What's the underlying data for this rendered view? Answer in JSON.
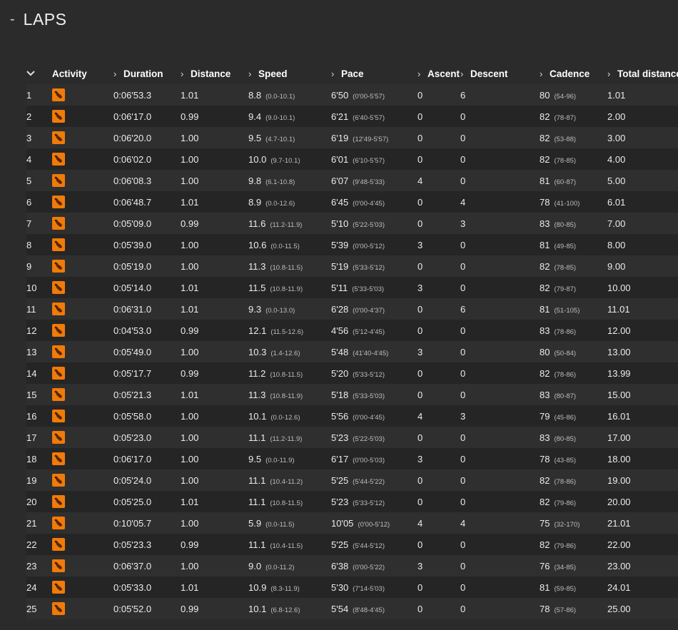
{
  "section": {
    "toggle": "-",
    "title": "LAPS"
  },
  "table": {
    "columns": [
      "Activity",
      "Duration",
      "Distance",
      "Speed",
      "Pace",
      "Ascent",
      "Descent",
      "Cadence",
      "Total distance"
    ],
    "icon": "running-shoe-icon",
    "accent": "#f07a0a",
    "rows": [
      {
        "n": "1",
        "dur": "0:06'53.3",
        "dist": "1.01",
        "spd": "8.8",
        "spdr": "(0.0-10.1)",
        "pace": "6'50",
        "pacer": "(0'00-5'57)",
        "asc": "0",
        "desc": "6",
        "cad": "80",
        "cadr": "(54-96)",
        "tot": "1.01"
      },
      {
        "n": "2",
        "dur": "0:06'17.0",
        "dist": "0.99",
        "spd": "9.4",
        "spdr": "(9.0-10.1)",
        "pace": "6'21",
        "pacer": "(6'40-5'57)",
        "asc": "0",
        "desc": "0",
        "cad": "82",
        "cadr": "(78-87)",
        "tot": "2.00"
      },
      {
        "n": "3",
        "dur": "0:06'20.0",
        "dist": "1.00",
        "spd": "9.5",
        "spdr": "(4.7-10.1)",
        "pace": "6'19",
        "pacer": "(12'49-5'57)",
        "asc": "0",
        "desc": "0",
        "cad": "82",
        "cadr": "(53-88)",
        "tot": "3.00"
      },
      {
        "n": "4",
        "dur": "0:06'02.0",
        "dist": "1.00",
        "spd": "10.0",
        "spdr": "(9.7-10.1)",
        "pace": "6'01",
        "pacer": "(6'10-5'57)",
        "asc": "0",
        "desc": "0",
        "cad": "82",
        "cadr": "(78-85)",
        "tot": "4.00"
      },
      {
        "n": "5",
        "dur": "0:06'08.3",
        "dist": "1.00",
        "spd": "9.8",
        "spdr": "(6.1-10.8)",
        "pace": "6'07",
        "pacer": "(9'48-5'33)",
        "asc": "4",
        "desc": "0",
        "cad": "81",
        "cadr": "(60-87)",
        "tot": "5.00"
      },
      {
        "n": "6",
        "dur": "0:06'48.7",
        "dist": "1.01",
        "spd": "8.9",
        "spdr": "(0.0-12.6)",
        "pace": "6'45",
        "pacer": "(0'00-4'45)",
        "asc": "0",
        "desc": "4",
        "cad": "78",
        "cadr": "(41-100)",
        "tot": "6.01"
      },
      {
        "n": "7",
        "dur": "0:05'09.0",
        "dist": "0.99",
        "spd": "11.6",
        "spdr": "(11.2-11.9)",
        "pace": "5'10",
        "pacer": "(5'22-5'03)",
        "asc": "0",
        "desc": "3",
        "cad": "83",
        "cadr": "(80-85)",
        "tot": "7.00"
      },
      {
        "n": "8",
        "dur": "0:05'39.0",
        "dist": "1.00",
        "spd": "10.6",
        "spdr": "(0.0-11.5)",
        "pace": "5'39",
        "pacer": "(0'00-5'12)",
        "asc": "3",
        "desc": "0",
        "cad": "81",
        "cadr": "(49-85)",
        "tot": "8.00"
      },
      {
        "n": "9",
        "dur": "0:05'19.0",
        "dist": "1.00",
        "spd": "11.3",
        "spdr": "(10.8-11.5)",
        "pace": "5'19",
        "pacer": "(5'33-5'12)",
        "asc": "0",
        "desc": "0",
        "cad": "82",
        "cadr": "(78-85)",
        "tot": "9.00"
      },
      {
        "n": "10",
        "dur": "0:05'14.0",
        "dist": "1.01",
        "spd": "11.5",
        "spdr": "(10.8-11.9)",
        "pace": "5'11",
        "pacer": "(5'33-5'03)",
        "asc": "3",
        "desc": "0",
        "cad": "82",
        "cadr": "(79-87)",
        "tot": "10.00"
      },
      {
        "n": "11",
        "dur": "0:06'31.0",
        "dist": "1.01",
        "spd": "9.3",
        "spdr": "(0.0-13.0)",
        "pace": "6'28",
        "pacer": "(0'00-4'37)",
        "asc": "0",
        "desc": "6",
        "cad": "81",
        "cadr": "(51-105)",
        "tot": "11.01"
      },
      {
        "n": "12",
        "dur": "0:04'53.0",
        "dist": "0.99",
        "spd": "12.1",
        "spdr": "(11.5-12.6)",
        "pace": "4'56",
        "pacer": "(5'12-4'45)",
        "asc": "0",
        "desc": "0",
        "cad": "83",
        "cadr": "(78-86)",
        "tot": "12.00"
      },
      {
        "n": "13",
        "dur": "0:05'49.0",
        "dist": "1.00",
        "spd": "10.3",
        "spdr": "(1.4-12.6)",
        "pace": "5'48",
        "pacer": "(41'40-4'45)",
        "asc": "3",
        "desc": "0",
        "cad": "80",
        "cadr": "(50-84)",
        "tot": "13.00"
      },
      {
        "n": "14",
        "dur": "0:05'17.7",
        "dist": "0.99",
        "spd": "11.2",
        "spdr": "(10.8-11.5)",
        "pace": "5'20",
        "pacer": "(5'33-5'12)",
        "asc": "0",
        "desc": "0",
        "cad": "82",
        "cadr": "(78-86)",
        "tot": "13.99"
      },
      {
        "n": "15",
        "dur": "0:05'21.3",
        "dist": "1.01",
        "spd": "11.3",
        "spdr": "(10.8-11.9)",
        "pace": "5'18",
        "pacer": "(5'33-5'03)",
        "asc": "0",
        "desc": "0",
        "cad": "83",
        "cadr": "(80-87)",
        "tot": "15.00"
      },
      {
        "n": "16",
        "dur": "0:05'58.0",
        "dist": "1.00",
        "spd": "10.1",
        "spdr": "(0.0-12.6)",
        "pace": "5'56",
        "pacer": "(0'00-4'45)",
        "asc": "4",
        "desc": "3",
        "cad": "79",
        "cadr": "(45-86)",
        "tot": "16.01"
      },
      {
        "n": "17",
        "dur": "0:05'23.0",
        "dist": "1.00",
        "spd": "11.1",
        "spdr": "(11.2-11.9)",
        "pace": "5'23",
        "pacer": "(5'22-5'03)",
        "asc": "0",
        "desc": "0",
        "cad": "83",
        "cadr": "(80-85)",
        "tot": "17.00"
      },
      {
        "n": "18",
        "dur": "0:06'17.0",
        "dist": "1.00",
        "spd": "9.5",
        "spdr": "(0.0-11.9)",
        "pace": "6'17",
        "pacer": "(0'00-5'03)",
        "asc": "3",
        "desc": "0",
        "cad": "78",
        "cadr": "(43-85)",
        "tot": "18.00"
      },
      {
        "n": "19",
        "dur": "0:05'24.0",
        "dist": "1.00",
        "spd": "11.1",
        "spdr": "(10.4-11.2)",
        "pace": "5'25",
        "pacer": "(5'44-5'22)",
        "asc": "0",
        "desc": "0",
        "cad": "82",
        "cadr": "(78-86)",
        "tot": "19.00"
      },
      {
        "n": "20",
        "dur": "0:05'25.0",
        "dist": "1.01",
        "spd": "11.1",
        "spdr": "(10.8-11.5)",
        "pace": "5'23",
        "pacer": "(5'33-5'12)",
        "asc": "0",
        "desc": "0",
        "cad": "82",
        "cadr": "(79-86)",
        "tot": "20.00"
      },
      {
        "n": "21",
        "dur": "0:10'05.7",
        "dist": "1.00",
        "spd": "5.9",
        "spdr": "(0.0-11.5)",
        "pace": "10'05",
        "pacer": "(0'00-5'12)",
        "asc": "4",
        "desc": "4",
        "cad": "75",
        "cadr": "(32-170)",
        "tot": "21.01"
      },
      {
        "n": "22",
        "dur": "0:05'23.3",
        "dist": "0.99",
        "spd": "11.1",
        "spdr": "(10.4-11.5)",
        "pace": "5'25",
        "pacer": "(5'44-5'12)",
        "asc": "0",
        "desc": "0",
        "cad": "82",
        "cadr": "(79-86)",
        "tot": "22.00"
      },
      {
        "n": "23",
        "dur": "0:06'37.0",
        "dist": "1.00",
        "spd": "9.0",
        "spdr": "(0.0-11.2)",
        "pace": "6'38",
        "pacer": "(0'00-5'22)",
        "asc": "3",
        "desc": "0",
        "cad": "76",
        "cadr": "(34-85)",
        "tot": "23.00"
      },
      {
        "n": "24",
        "dur": "0:05'33.0",
        "dist": "1.01",
        "spd": "10.9",
        "spdr": "(8.3-11.9)",
        "pace": "5'30",
        "pacer": "(7'14-5'03)",
        "asc": "0",
        "desc": "0",
        "cad": "81",
        "cadr": "(59-85)",
        "tot": "24.01"
      },
      {
        "n": "25",
        "dur": "0:05'52.0",
        "dist": "0.99",
        "spd": "10.1",
        "spdr": "(6.8-12.6)",
        "pace": "5'54",
        "pacer": "(8'48-4'45)",
        "asc": "0",
        "desc": "0",
        "cad": "78",
        "cadr": "(57-86)",
        "tot": "25.00"
      }
    ]
  }
}
